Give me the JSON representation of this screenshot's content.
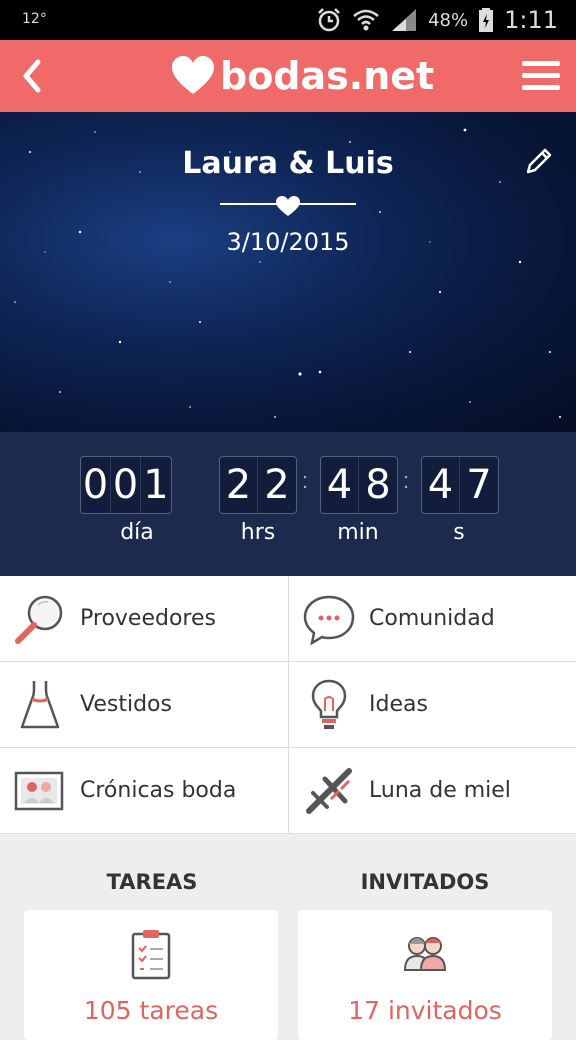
{
  "status_bar": {
    "temperature": "12°",
    "battery": "48%",
    "time": "1:11"
  },
  "app_bar": {
    "brand": "bodas.net",
    "brand_color": "#ef6a68"
  },
  "hero": {
    "names": "Laura & Luis",
    "date": "3/10/2015"
  },
  "countdown": {
    "days": {
      "digits": [
        "0",
        "0",
        "1"
      ],
      "label": "día"
    },
    "hours": {
      "digits": [
        "2",
        "2"
      ],
      "label": "hrs"
    },
    "minutes": {
      "digits": [
        "4",
        "8"
      ],
      "label": "min"
    },
    "seconds": {
      "digits": [
        "4",
        "7"
      ],
      "label": "s"
    }
  },
  "menu": {
    "items": [
      {
        "label": "Proveedores",
        "icon": "magnifier-icon"
      },
      {
        "label": "Comunidad",
        "icon": "chat-bubble-icon"
      },
      {
        "label": "Vestidos",
        "icon": "dress-icon"
      },
      {
        "label": "Ideas",
        "icon": "lightbulb-icon"
      },
      {
        "label": "Crónicas boda",
        "icon": "photo-icon"
      },
      {
        "label": "Luna de miel",
        "icon": "airplane-icon"
      }
    ]
  },
  "summary": {
    "tasks": {
      "title": "TAREAS",
      "value": "105 tareas",
      "icon": "clipboard-icon"
    },
    "guests": {
      "title": "INVITADOS",
      "value": "17 invitados",
      "icon": "guests-icon"
    }
  }
}
